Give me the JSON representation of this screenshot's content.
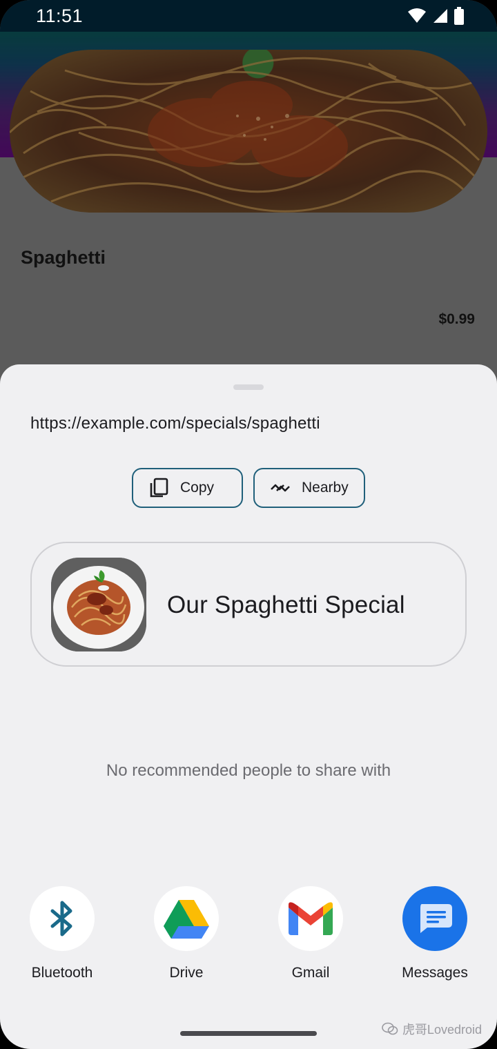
{
  "status_bar": {
    "time": "11:51",
    "icons": [
      "wifi-icon",
      "cell-signal-icon",
      "battery-icon"
    ]
  },
  "background_app": {
    "food_name": "Spaghetti",
    "price": "$0.99"
  },
  "share_sheet": {
    "url": "https://example.com/specials/spaghetti",
    "actions": [
      {
        "label": "Copy",
        "icon": "copy-icon"
      },
      {
        "label": "Nearby",
        "icon": "nearby-share-icon"
      }
    ],
    "preview": {
      "title": "Our Spaghetti Special",
      "thumbnail": "spaghetti-plate-image"
    },
    "no_recommendations": "No recommended people to share with",
    "targets": [
      {
        "label": "Bluetooth",
        "icon": "bluetooth-icon"
      },
      {
        "label": "Drive",
        "icon": "drive-icon"
      },
      {
        "label": "Gmail",
        "icon": "gmail-icon"
      },
      {
        "label": "Messages",
        "icon": "messages-icon"
      }
    ]
  },
  "watermark": "虎哥Lovedroid",
  "colors": {
    "chip_border": "#1f5f7a",
    "sheet_bg": "#f0f0f2",
    "bluetooth": "#1a6a8a",
    "messages": "#1a73e8"
  }
}
